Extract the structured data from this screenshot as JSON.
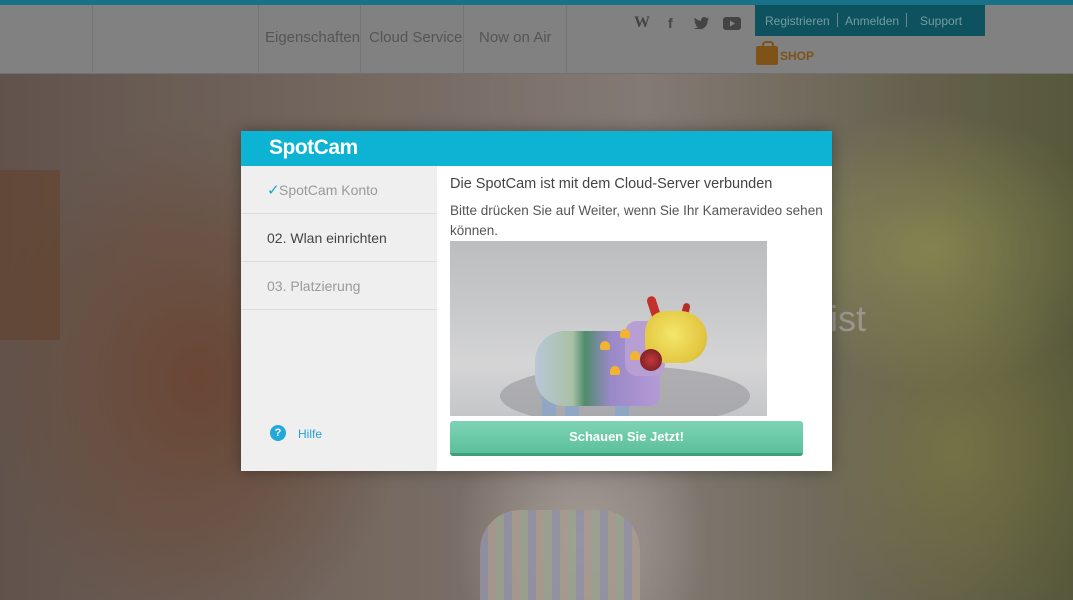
{
  "background_page": {
    "nav": [
      "Eigenschaften",
      "Cloud Service",
      "Now on Air"
    ],
    "social_icons": [
      "wordpress-icon",
      "facebook-icon",
      "twitter-icon",
      "youtube-icon"
    ],
    "top_menu": [
      "Registrieren",
      "Anmelden",
      "Support"
    ],
    "shop_label": "SHOP",
    "hero_text_fragment": "ist"
  },
  "modal": {
    "logo": "SpotCam",
    "accent_color": "#0cb3d3",
    "steps": [
      {
        "label": "SpotCam Konto",
        "state": "done"
      },
      {
        "label": "02. Wlan einrichten",
        "state": "current"
      },
      {
        "label": "03. Platzierung",
        "state": "pending"
      }
    ],
    "help": {
      "icon": "question-icon",
      "label": "Hilfe"
    },
    "title": "Die SpotCam ist mit dem Cloud-Server verbunden",
    "description": "Bitte drücken Sie auf Weiter, wenn Sie Ihr Kameravideo sehen können.",
    "video": {
      "content": "camera live view"
    },
    "watch_button": {
      "label": "Schauen Sie Jetzt!",
      "color": "#5cc09c"
    }
  }
}
